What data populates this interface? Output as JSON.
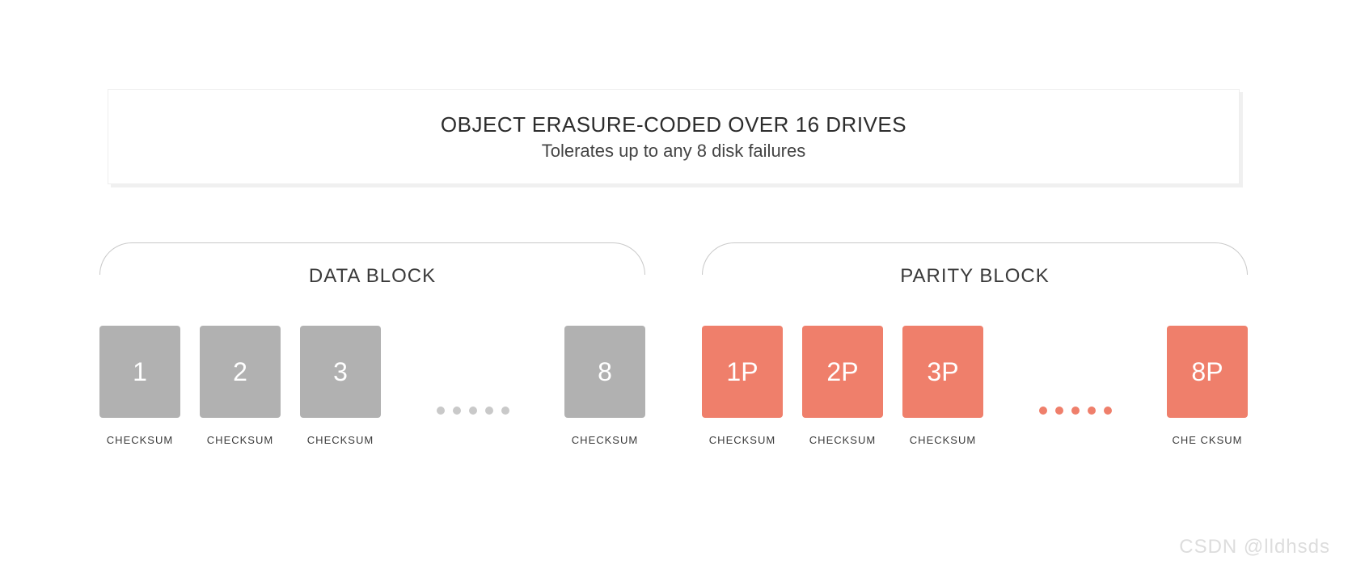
{
  "header": {
    "title": "OBJECT ERASURE-CODED OVER 16 DRIVES",
    "subtitle": "Tolerates up to any 8 disk failures"
  },
  "groups": {
    "data": {
      "label": "DATA BLOCK",
      "checksum_label": "CHECKSUM",
      "blocks": [
        "1",
        "2",
        "3",
        "8"
      ]
    },
    "parity": {
      "label": "PARITY BLOCK",
      "checksum_label": "CHECKSUM",
      "checksum_label_last": "CHE CKSUM",
      "blocks": [
        "1P",
        "2P",
        "3P",
        "8P"
      ]
    }
  },
  "colors": {
    "data_block": "#b1b1b1",
    "parity_block": "#ef7f6b"
  },
  "watermark": "CSDN @lldhsds"
}
